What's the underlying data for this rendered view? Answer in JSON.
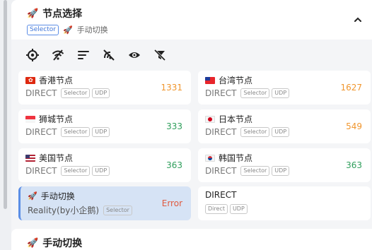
{
  "group": {
    "title": "节点选择",
    "type_chip": "Selector",
    "current": "手动切换"
  },
  "toolbar": [
    {
      "name": "locate-icon"
    },
    {
      "name": "wifi-off-icon"
    },
    {
      "name": "sort-icon"
    },
    {
      "name": "test-latency-icon"
    },
    {
      "name": "eye-icon"
    },
    {
      "name": "filter-off-icon"
    }
  ],
  "proxies": [
    {
      "name": "香港节点",
      "flag": "hk-flag-icon",
      "type": "DIRECT",
      "chips": [
        "Selector",
        "UDP"
      ],
      "delay": "1331",
      "delay_color": "#f0962e"
    },
    {
      "name": "台湾节点",
      "flag": "tw-flag-icon",
      "type": "DIRECT",
      "chips": [
        "Selector",
        "UDP"
      ],
      "delay": "1627",
      "delay_color": "#f0962e"
    },
    {
      "name": "狮城节点",
      "flag": "sg-flag-icon",
      "type": "DIRECT",
      "chips": [
        "Selector",
        "UDP"
      ],
      "delay": "333",
      "delay_color": "#2e9e5b"
    },
    {
      "name": "日本节点",
      "flag": "jp-flag-icon",
      "type": "DIRECT",
      "chips": [
        "Selector",
        "UDP"
      ],
      "delay": "549",
      "delay_color": "#f0962e"
    },
    {
      "name": "美国节点",
      "flag": "us-flag-icon",
      "type": "DIRECT",
      "chips": [
        "Selector",
        "UDP"
      ],
      "delay": "363",
      "delay_color": "#2e9e5b"
    },
    {
      "name": "韩国节点",
      "flag": "kr-flag-icon",
      "type": "DIRECT",
      "chips": [
        "Selector",
        "UDP"
      ],
      "delay": "363",
      "delay_color": "#2e9e5b"
    },
    {
      "name": "手动切换",
      "flag": "rocket-icon",
      "type": "Reality(by小企鹅)",
      "chips": [
        "Selector"
      ],
      "delay": "Error",
      "delay_color": "#e05a3f",
      "active": true
    },
    {
      "name": "DIRECT",
      "flag": "",
      "type": "",
      "chips": [
        "Direct",
        "UDP"
      ],
      "delay": ""
    }
  ],
  "next_group": {
    "title": "手动切换"
  }
}
